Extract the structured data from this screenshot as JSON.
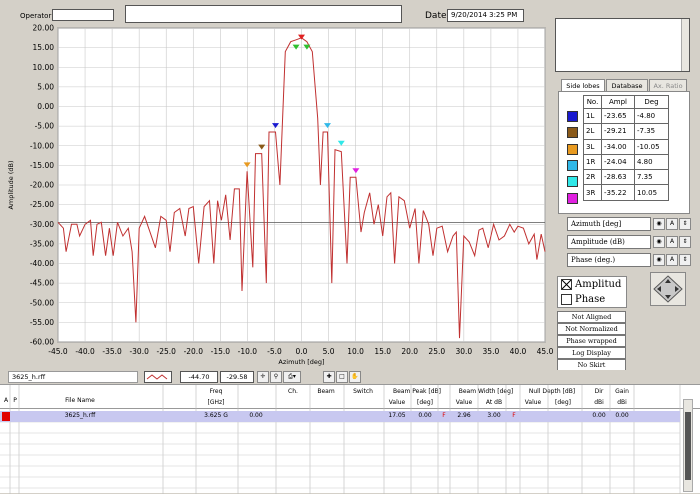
{
  "header": {
    "operator_label": "Operator:",
    "operator_value": "",
    "title_value": "",
    "date_label": "Date",
    "date_value": "9/20/2014 3:25 PM"
  },
  "tabs": [
    {
      "label": "Side lobes"
    },
    {
      "label": "Database"
    },
    {
      "label": "Ax. Ratio"
    }
  ],
  "sidelobes": {
    "headers": [
      "No.",
      "Ampl",
      "Deg"
    ],
    "rows": [
      {
        "no": "1L",
        "ampl": "-23.65",
        "deg": "-4.80",
        "color": "#1a1ad0"
      },
      {
        "no": "2L",
        "ampl": "-29.21",
        "deg": "-7.35",
        "color": "#8a5a1a"
      },
      {
        "no": "3L",
        "ampl": "-34.00",
        "deg": "-10.05",
        "color": "#e89a20"
      },
      {
        "no": "1R",
        "ampl": "-24.04",
        "deg": "4.80",
        "color": "#30b8e8"
      },
      {
        "no": "2R",
        "ampl": "-28.63",
        "deg": "7.35",
        "color": "#30e8e8"
      },
      {
        "no": "3R",
        "ampl": "-35.22",
        "deg": "10.05",
        "color": "#e020e0"
      }
    ]
  },
  "axis_controls": [
    {
      "label": "Azimuth [deg]"
    },
    {
      "label": "Amplitude (dB)"
    },
    {
      "label": "Phase (deg.)"
    }
  ],
  "legend": {
    "amplitude_label": "Amplitud",
    "phase_label": "Phase",
    "amplitude_checked": true,
    "phase_checked": false
  },
  "options": [
    {
      "label": "Not Aligned"
    },
    {
      "label": "Not Normalized"
    },
    {
      "label": "Phase wrapped"
    },
    {
      "label": "Log Display"
    },
    {
      "label": "No Skirt"
    }
  ],
  "toolbar": {
    "file_label": "3625_h.rff",
    "cursor_x": "-44.70",
    "cursor_y": "-29.58"
  },
  "grid": {
    "col_a": "A",
    "col_p": "P",
    "file_name_header": "File Name",
    "freq_header": "Freq",
    "freq_unit": "[GHz]",
    "ch_header": "Ch.",
    "beam_header": "Beam",
    "switch_header": "Switch",
    "beam_peak_header": "Beam Peak [dB]",
    "beam_width_header": "Beam Width [deg]",
    "null_depth_header": "Null Depth [dB]",
    "dir_header": "Dir",
    "gain_header": "Gain",
    "value_label": "Value",
    "deg_label": "[deg]",
    "at_db_label": "At dB",
    "dbi_label": "dBi",
    "row": {
      "file_name": "3625_h.rff",
      "freq": "3.625 G",
      "ch_value": "0.00",
      "beam_peak_value": "17.05",
      "beam_peak_deg": "0.00",
      "flag1": "F",
      "beam_width_value": "2.96",
      "beam_width_at": "3.00",
      "flag2": "F",
      "dir": "0.00",
      "gain": "0.00"
    }
  },
  "chart_data": {
    "type": "line",
    "xlabel": "Azimuth [deg]",
    "ylabel": "Amplitude (dB)",
    "xlim": [
      -45,
      45
    ],
    "ylim": [
      -60,
      20
    ],
    "x_ticks": [
      -45,
      -40,
      -35,
      -30,
      -25,
      -20,
      -15,
      -10,
      -5,
      0,
      5,
      10,
      15,
      20,
      25,
      30,
      35,
      40,
      45
    ],
    "x_tick_labels": [
      "-45.0",
      "-40.0",
      "-35.0",
      "-30.0",
      "-25.0",
      "-20.0",
      "-15.0",
      "-10.0",
      "-5.0",
      "0.0",
      "5.0",
      "10.0",
      "15.0",
      "20.0",
      "25.0",
      "30.0",
      "35.0",
      "40.0",
      "45.0"
    ],
    "y_ticks": [
      20,
      15,
      10,
      5,
      0,
      -5,
      -10,
      -15,
      -20,
      -25,
      -30,
      -35,
      -40,
      -45,
      -50,
      -55,
      -60
    ],
    "y_tick_labels": [
      "20.00",
      "15.00",
      "10.00",
      "5.00",
      "0.00",
      "-5.00",
      "-10.00",
      "-15.00",
      "-20.00",
      "-25.00",
      "-30.00",
      "-35.00",
      "-40.00",
      "-45.00",
      "-50.00",
      "-55.00",
      "-60.00"
    ],
    "grid": true,
    "reference_line_y": -29.58,
    "line_color": "#c03030",
    "x": [
      -45,
      -44,
      -43.5,
      -42.5,
      -41.5,
      -41,
      -40,
      -39,
      -38.5,
      -37.8,
      -37,
      -36.2,
      -35.5,
      -34.8,
      -34,
      -33,
      -32,
      -31.3,
      -30.6,
      -30,
      -29,
      -28,
      -27,
      -26,
      -25,
      -24.3,
      -23.5,
      -22.5,
      -21.5,
      -20.8,
      -20,
      -19,
      -18,
      -17,
      -16.2,
      -15.5,
      -14.8,
      -14,
      -13.2,
      -12.4,
      -11.5,
      -11,
      -10.05,
      -9,
      -8.5,
      -7.35,
      -6.5,
      -6,
      -4.8,
      -4,
      -3.5,
      -3,
      -2,
      -1,
      0,
      1,
      2,
      3,
      3.5,
      4,
      4.8,
      5.6,
      6.2,
      7.35,
      8.4,
      9,
      10.05,
      11,
      11.6,
      12.6,
      13.4,
      14.2,
      15,
      15.8,
      16.5,
      17.2,
      18,
      19,
      20,
      21,
      21.7,
      22.5,
      23.5,
      24.3,
      25,
      26,
      27,
      28,
      28.6,
      29.2,
      30,
      31,
      32,
      32.8,
      33.5,
      34.5,
      35.5,
      36.5,
      37.5,
      38.5,
      39.3,
      40,
      41,
      42,
      43,
      43.5,
      44.3,
      45
    ],
    "y": [
      -29.5,
      -31,
      -37,
      -30,
      -30,
      -33,
      -30,
      -29,
      -38,
      -30,
      -29.5,
      -38,
      -31,
      -38,
      -29.5,
      -33,
      -31,
      -37,
      -55,
      -31,
      -28,
      -32,
      -36,
      -28,
      -29,
      -37,
      -27,
      -26,
      -33,
      -26,
      -25.5,
      -40,
      -25.5,
      -24,
      -40,
      -24,
      -29,
      -22.5,
      -34,
      -21,
      -21,
      -47,
      -16.5,
      -41,
      -12,
      -12,
      -45,
      -6.5,
      -6.5,
      -20,
      -3,
      14,
      16.5,
      17,
      17.5,
      16.5,
      14,
      -3,
      -20,
      -6.5,
      -6.5,
      -45,
      -11,
      -11.5,
      -40,
      -18,
      -18,
      -32,
      -27,
      -22,
      -30,
      -25,
      -33,
      -23,
      -22,
      -40,
      -23,
      -24,
      -31,
      -26,
      -40,
      -26.5,
      -30,
      -38,
      -31,
      -30.5,
      -37,
      -33,
      -32,
      -59,
      -33,
      -34.5,
      -38,
      -31.5,
      -31,
      -36,
      -30,
      -34,
      -33,
      -30,
      -32,
      -30.5,
      -31,
      -35,
      -32.5,
      -39,
      -32.5,
      -37
    ],
    "markers": [
      {
        "x": -1,
        "y": 14.5,
        "color": "#30c030",
        "dir": "down"
      },
      {
        "x": 1,
        "y": 14.5,
        "color": "#30c030",
        "dir": "down"
      },
      {
        "x": 0,
        "y": 17.05,
        "color": "#e02020",
        "dir": "down"
      },
      {
        "x": -4.8,
        "y": -5.5,
        "color": "#1a1ad0",
        "dir": "down"
      },
      {
        "x": -7.35,
        "y": -11,
        "color": "#8a5a1a",
        "dir": "down"
      },
      {
        "x": -10.05,
        "y": -15.5,
        "color": "#e89a20",
        "dir": "down"
      },
      {
        "x": 4.8,
        "y": -5.5,
        "color": "#30b8e8",
        "dir": "down"
      },
      {
        "x": 7.35,
        "y": -10,
        "color": "#30e8e8",
        "dir": "down"
      },
      {
        "x": 10.05,
        "y": -17,
        "color": "#e020e0",
        "dir": "down"
      }
    ]
  }
}
